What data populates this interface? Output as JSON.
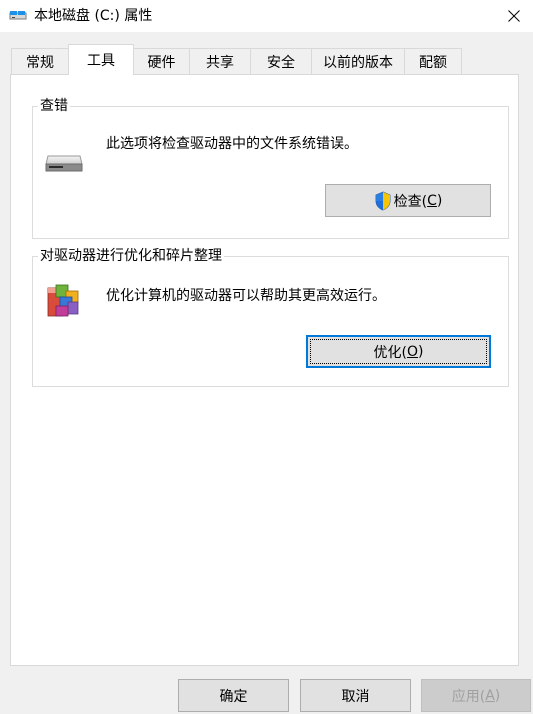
{
  "window": {
    "title": "本地磁盘 (C:) 属性",
    "title_icon": "drive-icon",
    "close_glyph": "✕"
  },
  "tabs": [
    {
      "label": "常规",
      "active": false
    },
    {
      "label": "工具",
      "active": true
    },
    {
      "label": "硬件",
      "active": false
    },
    {
      "label": "共享",
      "active": false
    },
    {
      "label": "安全",
      "active": false
    },
    {
      "label": "以前的版本",
      "active": false
    },
    {
      "label": "配额",
      "active": false
    }
  ],
  "error_check": {
    "title": "查错",
    "description": "此选项将检查驱动器中的文件系统错误。",
    "button_label": "检查(C)",
    "button_text": "检查(",
    "button_mnemonic": "C",
    "button_close": ")",
    "icon": "hard-drive-icon",
    "shield_icon": "uac-shield-icon"
  },
  "optimize": {
    "title": "对驱动器进行优化和碎片整理",
    "description": "优化计算机的驱动器可以帮助其更高效运行。",
    "button_label": "优化(O)",
    "button_text": "优化(",
    "button_mnemonic": "O",
    "button_close": ")",
    "icon": "defrag-icon"
  },
  "footer": {
    "ok_label": "确定",
    "cancel_label": "取消",
    "apply_label": "应用(A)",
    "apply_text": "应用(",
    "apply_mnemonic": "A",
    "apply_close": ")"
  },
  "colors": {
    "accent": "#0078d7",
    "dialog_bg": "#f0f0f0",
    "button_bg": "#e1e1e1"
  }
}
